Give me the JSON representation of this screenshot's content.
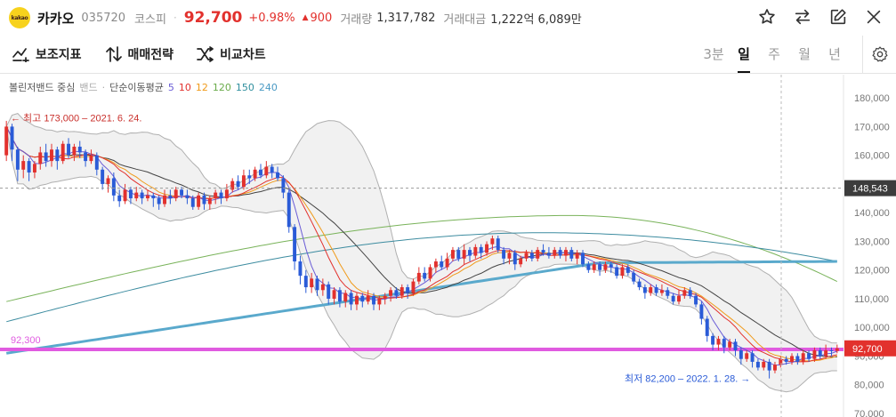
{
  "header": {
    "logo_text": "kakao",
    "name": "카카오",
    "code": "035720",
    "market": "코스피",
    "separator": "·",
    "price": "92,700",
    "change_pct": "+0.98%",
    "change_arrow": "▲",
    "change_value": "900",
    "volume_label": "거래량",
    "volume": "1,317,782",
    "amount_label": "거래대금",
    "amount": "1,222억 6,089만",
    "icons": [
      "star-icon",
      "swap-icon",
      "edit-icon",
      "close-icon"
    ]
  },
  "toolbar": {
    "tools": [
      {
        "icon": "indicator-icon",
        "label": "보조지표"
      },
      {
        "icon": "trade-strategy-icon",
        "label": "매매전략"
      },
      {
        "icon": "compare-icon",
        "label": "비교차트"
      }
    ],
    "periods": [
      "3분",
      "일",
      "주",
      "월",
      "년"
    ],
    "active_period": "일",
    "settings_icon": "gear-icon"
  },
  "legend": {
    "bollinger": "볼린저밴드 중심",
    "bollinger_band": "밴드",
    "separator": "·",
    "ma_label": "단순이동평균",
    "ma_periods": [
      {
        "label": "5",
        "color": "#6a5cd6"
      },
      {
        "label": "10",
        "color": "#e2312d"
      },
      {
        "label": "12",
        "color": "#f09a1a"
      },
      {
        "label": "120",
        "color": "#6aab4a"
      },
      {
        "label": "150",
        "color": "#2f8f9e"
      },
      {
        "label": "240",
        "color": "#4a9ac4"
      }
    ]
  },
  "chart_data": {
    "type": "candlestick",
    "y_axis": {
      "min": 70000,
      "max": 185000,
      "ticks": [
        "180,000",
        "170,000",
        "160,000",
        "150,000",
        "140,000",
        "130,000",
        "120,000",
        "110,000",
        "100,000",
        "90,000",
        "80,000",
        "70,000"
      ]
    },
    "high_annotation": "← 최고 173,000 – 2021. 6. 24.",
    "low_annotation": "최저 82,200 – 2022. 1. 28. →",
    "crosshair_price": "148,543",
    "current_price_tag": "92,700",
    "support_line_label": "92,300",
    "support_line_value": 92300,
    "colors": {
      "up": "#e2312d",
      "down": "#2a5bd7",
      "support": "#e05be0",
      "ma240": "#5aa9cc",
      "ma150": "#3d8ca0",
      "ma120": "#79b35a",
      "ma5": "#6a5cd6",
      "ma10": "#e2312d",
      "ma12": "#f09a1a",
      "center": "#444444",
      "band": "#b0b0b0"
    },
    "candles": [
      [
        160000,
        170000,
        172000,
        158000
      ],
      [
        170000,
        162000,
        171000,
        158000
      ],
      [
        162000,
        155000,
        163000,
        151000
      ],
      [
        155000,
        158000,
        160000,
        152000
      ],
      [
        158000,
        154000,
        159000,
        151000
      ],
      [
        154000,
        157000,
        158000,
        152000
      ],
      [
        157000,
        161000,
        163000,
        155000
      ],
      [
        161000,
        158000,
        164000,
        156000
      ],
      [
        158000,
        162000,
        164000,
        156000
      ],
      [
        162000,
        158000,
        163000,
        155000
      ],
      [
        158000,
        164000,
        165000,
        157000
      ],
      [
        164000,
        160000,
        166000,
        159000
      ],
      [
        160000,
        163000,
        164000,
        158000
      ],
      [
        163000,
        161000,
        165000,
        159000
      ],
      [
        161000,
        158000,
        162000,
        156000
      ],
      [
        158000,
        160000,
        162000,
        157000
      ],
      [
        160000,
        155000,
        161000,
        153000
      ],
      [
        155000,
        150000,
        156000,
        148000
      ],
      [
        150000,
        152000,
        153000,
        147000
      ],
      [
        152000,
        146000,
        154000,
        144000
      ],
      [
        146000,
        144000,
        148000,
        142000
      ],
      [
        144000,
        148000,
        150000,
        143000
      ],
      [
        148000,
        145000,
        149000,
        143000
      ],
      [
        145000,
        147000,
        149000,
        144000
      ],
      [
        147000,
        145000,
        148000,
        143000
      ],
      [
        145000,
        146000,
        148000,
        144000
      ],
      [
        146000,
        145000,
        147000,
        142000
      ],
      [
        145000,
        143000,
        146000,
        141000
      ],
      [
        143000,
        146000,
        148000,
        142000
      ],
      [
        146000,
        145000,
        148000,
        143000
      ],
      [
        145000,
        148000,
        149000,
        144000
      ],
      [
        148000,
        146000,
        149000,
        145000
      ],
      [
        146000,
        145000,
        148000,
        143000
      ],
      [
        145000,
        142000,
        146000,
        141000
      ],
      [
        142000,
        146000,
        147000,
        141000
      ],
      [
        146000,
        143000,
        147000,
        141000
      ],
      [
        143000,
        145000,
        146000,
        141000
      ],
      [
        145000,
        147000,
        148000,
        143000
      ],
      [
        147000,
        145000,
        148000,
        143000
      ],
      [
        145000,
        148000,
        150000,
        144000
      ],
      [
        148000,
        151000,
        152000,
        147000
      ],
      [
        151000,
        149000,
        153000,
        148000
      ],
      [
        149000,
        153000,
        155000,
        148000
      ],
      [
        153000,
        152000,
        155000,
        150000
      ],
      [
        152000,
        155000,
        156000,
        151000
      ],
      [
        155000,
        153000,
        157000,
        152000
      ],
      [
        153000,
        156000,
        158000,
        152000
      ],
      [
        156000,
        154000,
        157000,
        152000
      ],
      [
        154000,
        152000,
        156000,
        151000
      ],
      [
        152000,
        147000,
        153000,
        145000
      ],
      [
        147000,
        135000,
        148000,
        133000
      ],
      [
        135000,
        123000,
        136000,
        120000
      ],
      [
        123000,
        118000,
        125000,
        115000
      ],
      [
        118000,
        114000,
        120000,
        112000
      ],
      [
        114000,
        117000,
        119000,
        112000
      ],
      [
        117000,
        113000,
        118000,
        111000
      ],
      [
        113000,
        115000,
        117000,
        111000
      ],
      [
        115000,
        110000,
        116000,
        108000
      ],
      [
        110000,
        113000,
        114000,
        108000
      ],
      [
        113000,
        109000,
        114000,
        107000
      ],
      [
        109000,
        112000,
        113000,
        107000
      ],
      [
        112000,
        108000,
        113000,
        106000
      ],
      [
        108000,
        111000,
        112000,
        106000
      ],
      [
        111000,
        109000,
        112000,
        107000
      ],
      [
        109000,
        111000,
        113000,
        108000
      ],
      [
        111000,
        108000,
        112000,
        106000
      ],
      [
        108000,
        110000,
        111000,
        106000
      ],
      [
        110000,
        111000,
        112000,
        108000
      ],
      [
        111000,
        113000,
        114000,
        109000
      ],
      [
        113000,
        111000,
        114000,
        110000
      ],
      [
        111000,
        114000,
        115000,
        110000
      ],
      [
        114000,
        112000,
        115000,
        110000
      ],
      [
        112000,
        116000,
        117000,
        111000
      ],
      [
        116000,
        119000,
        121000,
        115000
      ],
      [
        119000,
        117000,
        121000,
        116000
      ],
      [
        117000,
        121000,
        122000,
        116000
      ],
      [
        121000,
        123000,
        124000,
        119000
      ],
      [
        123000,
        121000,
        125000,
        120000
      ],
      [
        121000,
        124000,
        126000,
        120000
      ],
      [
        124000,
        127000,
        128000,
        123000
      ],
      [
        127000,
        124000,
        128000,
        123000
      ],
      [
        124000,
        127000,
        129000,
        122000
      ],
      [
        127000,
        125000,
        128000,
        123000
      ],
      [
        125000,
        128000,
        129000,
        124000
      ],
      [
        128000,
        126000,
        129000,
        124000
      ],
      [
        126000,
        129000,
        130000,
        125000
      ],
      [
        129000,
        131000,
        132000,
        127000
      ],
      [
        131000,
        127000,
        132000,
        126000
      ],
      [
        127000,
        124000,
        128000,
        122000
      ],
      [
        124000,
        126000,
        127000,
        122000
      ],
      [
        126000,
        122000,
        127000,
        120000
      ],
      [
        122000,
        124000,
        125000,
        121000
      ],
      [
        124000,
        126000,
        127000,
        123000
      ],
      [
        126000,
        124000,
        127000,
        123000
      ],
      [
        124000,
        127000,
        128000,
        123000
      ],
      [
        127000,
        126000,
        129000,
        125000
      ],
      [
        126000,
        125000,
        128000,
        124000
      ],
      [
        125000,
        127000,
        128000,
        124000
      ],
      [
        127000,
        125000,
        128000,
        124000
      ],
      [
        125000,
        127000,
        128000,
        123000
      ],
      [
        127000,
        124000,
        128000,
        123000
      ],
      [
        124000,
        126000,
        127000,
        122000
      ],
      [
        126000,
        122000,
        127000,
        121000
      ],
      [
        122000,
        120000,
        123000,
        119000
      ],
      [
        120000,
        122000,
        123000,
        119000
      ],
      [
        122000,
        120000,
        123000,
        118000
      ],
      [
        120000,
        122000,
        123000,
        119000
      ],
      [
        122000,
        121000,
        123000,
        119000
      ],
      [
        121000,
        118000,
        122000,
        117000
      ],
      [
        118000,
        121000,
        122000,
        117000
      ],
      [
        121000,
        119000,
        122000,
        118000
      ],
      [
        119000,
        116000,
        120000,
        115000
      ],
      [
        116000,
        114000,
        117000,
        113000
      ],
      [
        114000,
        112000,
        115000,
        110000
      ],
      [
        112000,
        114000,
        115000,
        111000
      ],
      [
        114000,
        112000,
        115000,
        111000
      ],
      [
        112000,
        113000,
        115000,
        111000
      ],
      [
        113000,
        111000,
        114000,
        110000
      ],
      [
        111000,
        109000,
        112000,
        108000
      ],
      [
        109000,
        111000,
        113000,
        108000
      ],
      [
        111000,
        113000,
        114000,
        110000
      ],
      [
        113000,
        111000,
        114000,
        110000
      ],
      [
        111000,
        108000,
        112000,
        107000
      ],
      [
        108000,
        103000,
        109000,
        101000
      ],
      [
        103000,
        97000,
        104000,
        95000
      ],
      [
        97000,
        94000,
        98000,
        92000
      ],
      [
        94000,
        96000,
        97000,
        92000
      ],
      [
        96000,
        93000,
        97000,
        91000
      ],
      [
        93000,
        95000,
        96000,
        92000
      ],
      [
        95000,
        92000,
        96000,
        90000
      ],
      [
        92000,
        89000,
        93000,
        87000
      ],
      [
        89000,
        91000,
        92000,
        88000
      ],
      [
        91000,
        88000,
        92000,
        86000
      ],
      [
        88000,
        86000,
        89000,
        85000
      ],
      [
        86000,
        88000,
        89000,
        85000
      ],
      [
        88000,
        85000,
        89000,
        82200
      ],
      [
        85000,
        87000,
        88000,
        84000
      ],
      [
        87000,
        89000,
        90000,
        86000
      ],
      [
        89000,
        88000,
        90000,
        87000
      ],
      [
        88000,
        90000,
        91000,
        87000
      ],
      [
        90000,
        88000,
        91000,
        87000
      ],
      [
        88000,
        91000,
        92000,
        87000
      ],
      [
        91000,
        89000,
        92000,
        88000
      ],
      [
        89000,
        92000,
        93000,
        88000
      ],
      [
        92000,
        90000,
        93000,
        89000
      ],
      [
        90000,
        92000,
        94000,
        89000
      ],
      [
        92000,
        91800,
        93000,
        90000
      ],
      [
        91800,
        92700,
        94000,
        91000
      ]
    ]
  }
}
